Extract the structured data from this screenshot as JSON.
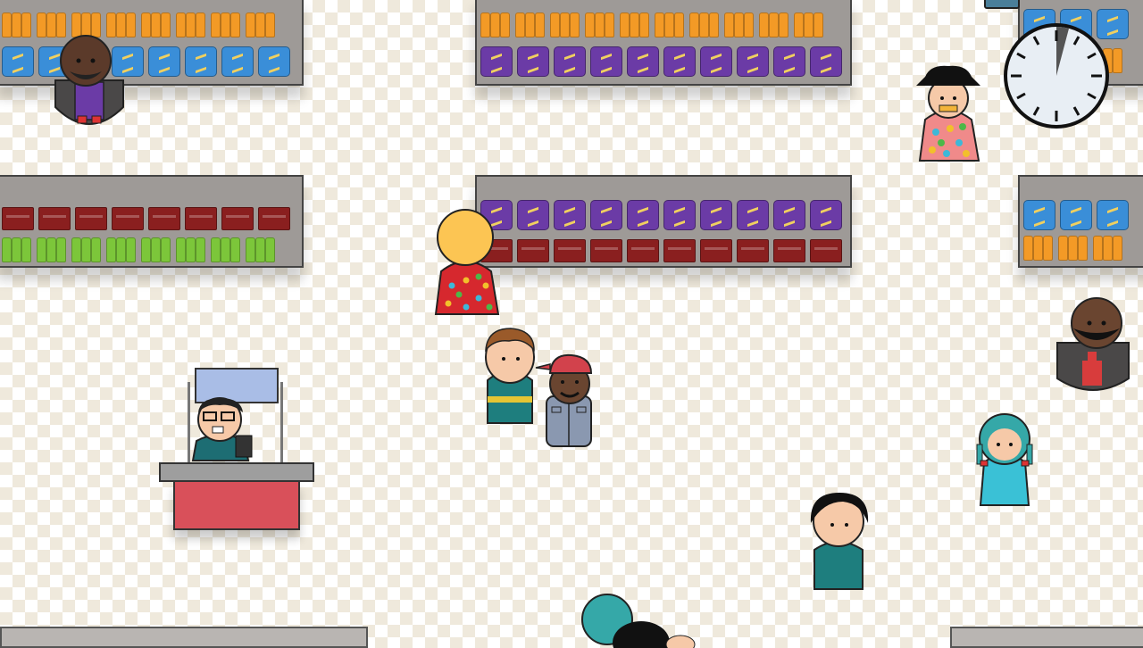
{
  "clock": {
    "icon": "wall-clock-icon",
    "face_color": "#e8eef4",
    "hand_color": "#555555"
  },
  "colors": {
    "orange_bottle": "#f39a26",
    "blue_bag": "#3a8ed8",
    "purple_bag": "#6b3ba6",
    "red_box": "#8a1f1f",
    "green_bottle": "#7cc63a",
    "floor_light": "#efe9dc",
    "counter_red": "#d9505a",
    "counter_top": "#9e9e9e",
    "monitor": "#a9bde6"
  },
  "shelves": [
    {
      "name": "shelf-top-left",
      "rows": [
        "orange_bottle",
        "blue_bag"
      ]
    },
    {
      "name": "shelf-top-center",
      "rows": [
        "orange_bottle",
        "purple_bag"
      ]
    },
    {
      "name": "shelf-top-right",
      "rows": [
        "blue_bag",
        "orange_bottle"
      ]
    },
    {
      "name": "shelf-mid-left",
      "rows": [
        "red_box",
        "green_bottle"
      ]
    },
    {
      "name": "shelf-mid-center",
      "rows": [
        "purple_bag",
        "red_box"
      ]
    },
    {
      "name": "shelf-mid-right",
      "rows": [
        "blue_bag",
        "orange_bottle"
      ]
    }
  ],
  "characters": [
    {
      "name": "shopper-bald-dark",
      "role": "shopper"
    },
    {
      "name": "shopper-hat-floral",
      "role": "shopper"
    },
    {
      "name": "shopper-yellow-hair-floral",
      "role": "shopper"
    },
    {
      "name": "player-brown-hair",
      "role": "player"
    },
    {
      "name": "shopper-red-cap",
      "role": "shopper"
    },
    {
      "name": "cashier-glasses",
      "role": "cashier"
    },
    {
      "name": "shopper-bald-bearded",
      "role": "shopper"
    },
    {
      "name": "shopper-teal-pigtails",
      "role": "shopper"
    },
    {
      "name": "shopper-black-hair",
      "role": "shopper"
    },
    {
      "name": "shopper-teal-hair-bottom",
      "role": "shopper"
    },
    {
      "name": "shopper-black-hair-bottom",
      "role": "shopper"
    }
  ]
}
